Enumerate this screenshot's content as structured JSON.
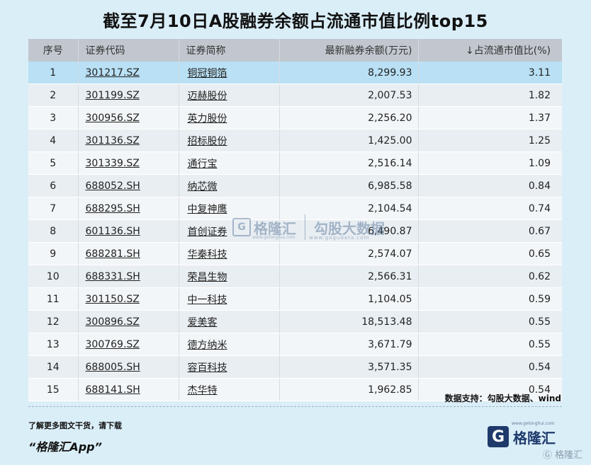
{
  "title": "截至7月10日A股融券余额占流通市值比例top15",
  "chart_data": {
    "type": "table",
    "columns": [
      "序号",
      "证券代码",
      "证券简称",
      "最新融券余额(万元)",
      "↓占流通市值比(%)"
    ],
    "rows": [
      {
        "idx": "1",
        "code": "301217.SZ",
        "name": "铜冠铜箔",
        "balance": "8,299.93",
        "ratio": "3.11"
      },
      {
        "idx": "2",
        "code": "301199.SZ",
        "name": "迈赫股份",
        "balance": "2,007.53",
        "ratio": "1.82"
      },
      {
        "idx": "3",
        "code": "300956.SZ",
        "name": "英力股份",
        "balance": "2,256.20",
        "ratio": "1.37"
      },
      {
        "idx": "4",
        "code": "301136.SZ",
        "name": "招标股份",
        "balance": "1,425.00",
        "ratio": "1.25"
      },
      {
        "idx": "5",
        "code": "301339.SZ",
        "name": "通行宝",
        "balance": "2,516.14",
        "ratio": "1.09"
      },
      {
        "idx": "6",
        "code": "688052.SH",
        "name": "纳芯微",
        "balance": "6,985.58",
        "ratio": "0.84"
      },
      {
        "idx": "7",
        "code": "688295.SH",
        "name": "中复神鹰",
        "balance": "2,104.54",
        "ratio": "0.74"
      },
      {
        "idx": "8",
        "code": "601136.SH",
        "name": "首创证券",
        "balance": "6,490.87",
        "ratio": "0.67"
      },
      {
        "idx": "9",
        "code": "688281.SH",
        "name": "华秦科技",
        "balance": "2,574.07",
        "ratio": "0.65"
      },
      {
        "idx": "10",
        "code": "688331.SH",
        "name": "荣昌生物",
        "balance": "2,566.31",
        "ratio": "0.62"
      },
      {
        "idx": "11",
        "code": "301150.SZ",
        "name": "中一科技",
        "balance": "1,104.05",
        "ratio": "0.59"
      },
      {
        "idx": "12",
        "code": "300896.SZ",
        "name": "爱美客",
        "balance": "18,513.48",
        "ratio": "0.55"
      },
      {
        "idx": "13",
        "code": "300769.SZ",
        "name": "德方纳米",
        "balance": "3,671.79",
        "ratio": "0.55"
      },
      {
        "idx": "14",
        "code": "688005.SH",
        "name": "容百科技",
        "balance": "3,571.35",
        "ratio": "0.54"
      },
      {
        "idx": "15",
        "code": "688141.SH",
        "name": "杰华特",
        "balance": "1,962.85",
        "ratio": "0.54"
      }
    ]
  },
  "source": "数据支持：勾股大数据、wind",
  "footer": {
    "download_text": "了解更多图文干货，请下载",
    "app_text": "“格隆汇App”",
    "brand_logo_glyph": "G",
    "brand_name": "格隆汇",
    "brand_url": "www.gelonghui.com",
    "corner_mark": "Ⓖ 格隆汇"
  },
  "watermark": {
    "logo_glyph": "G",
    "name1": "格隆汇",
    "url1": "www.gelonghui.com",
    "name2": "勾股大数据",
    "url2": "www.gogudata.com"
  },
  "colors": {
    "background": "#daeef8",
    "header": "#c2c7cf",
    "highlight_row": "#b9e0f4",
    "brand": "#1e3a6b"
  }
}
